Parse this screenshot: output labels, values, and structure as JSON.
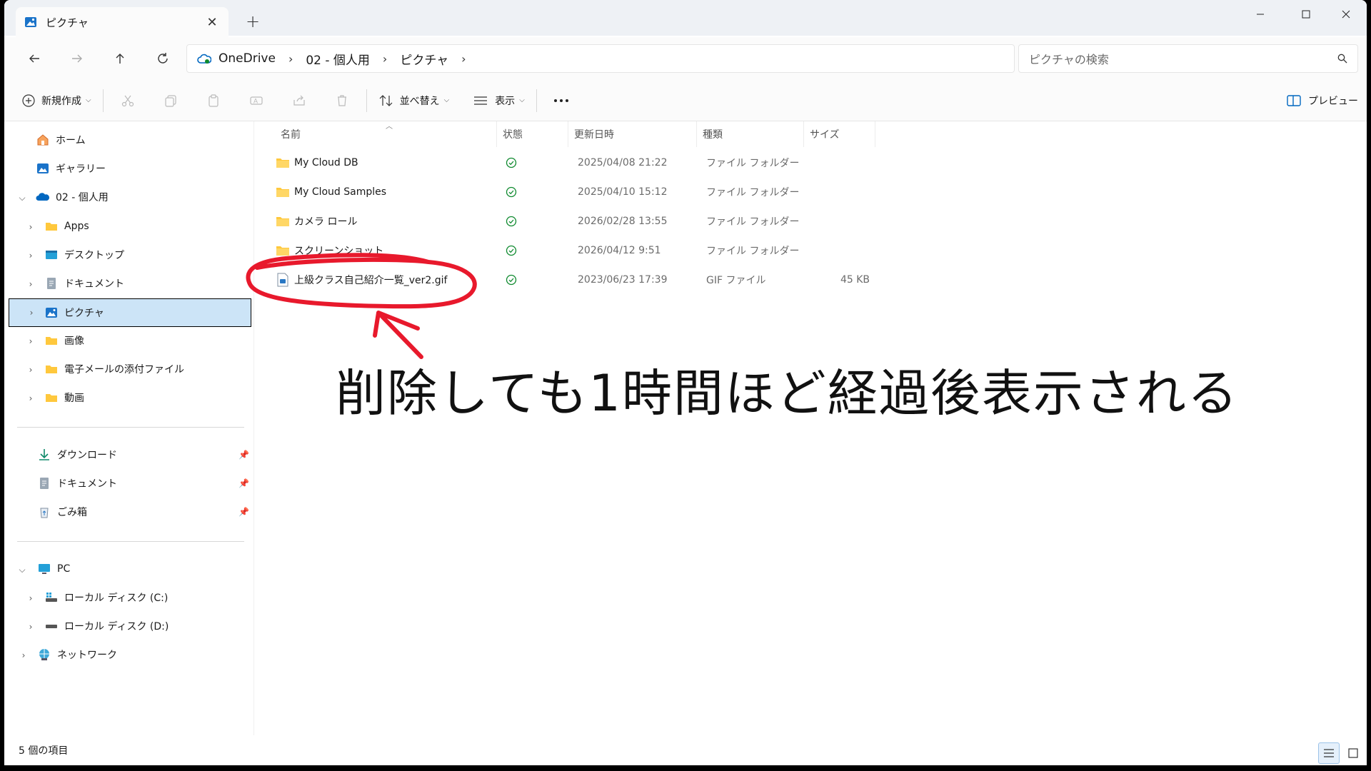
{
  "tab": {
    "title": "ピクチャ"
  },
  "address": {
    "crumbs": [
      "OneDrive",
      "02 - 個人用",
      "ピクチャ"
    ]
  },
  "search": {
    "placeholder": "ピクチャの検索"
  },
  "command_bar": {
    "new_label": "新規作成",
    "sort_label": "並べ替え",
    "view_label": "表示",
    "preview_label": "プレビュー"
  },
  "sidebar": {
    "home": "ホーム",
    "gallery": "ギャラリー",
    "onedrive": "02 - 個人用",
    "children": [
      "Apps",
      "デスクトップ",
      "ドキュメント",
      "ピクチャ",
      "画像",
      "電子メールの添付ファイル",
      "動画"
    ],
    "quick": [
      "ダウンロード",
      "ドキュメント",
      "ごみ箱"
    ],
    "pc": "PC",
    "drives": [
      "ローカル ディスク (C:)",
      "ローカル ディスク (D:)"
    ],
    "network": "ネットワーク"
  },
  "columns": {
    "name": "名前",
    "status": "状態",
    "modified": "更新日時",
    "type": "種類",
    "size": "サイズ"
  },
  "files": [
    {
      "name": "My Cloud DB",
      "modified": "2025/04/08 21:22",
      "type": "ファイル フォルダー",
      "size": "",
      "kind": "folder"
    },
    {
      "name": "My Cloud Samples",
      "modified": "2025/04/10 15:12",
      "type": "ファイル フォルダー",
      "size": "",
      "kind": "folder"
    },
    {
      "name": "カメラ ロール",
      "modified": "2026/02/28 13:55",
      "type": "ファイル フォルダー",
      "size": "",
      "kind": "folder"
    },
    {
      "name": "スクリーンショット",
      "modified": "2026/04/12 9:51",
      "type": "ファイル フォルダー",
      "size": "",
      "kind": "folder"
    },
    {
      "name": "上級クラス自己紹介一覧_ver2.gif",
      "modified": "2023/06/23 17:39",
      "type": "GIF ファイル",
      "size": "45 KB",
      "kind": "gif"
    }
  ],
  "status_bar": {
    "count": "5 個の項目"
  },
  "annotation": {
    "text": "削除しても1時間ほど経過後表示される",
    "color": "#e8192c"
  },
  "colors": {
    "accent": "#0067c0",
    "folder": "#ffc83d",
    "selected_bg": "#cce4f7",
    "sync_ok": "#0f8a2f"
  }
}
